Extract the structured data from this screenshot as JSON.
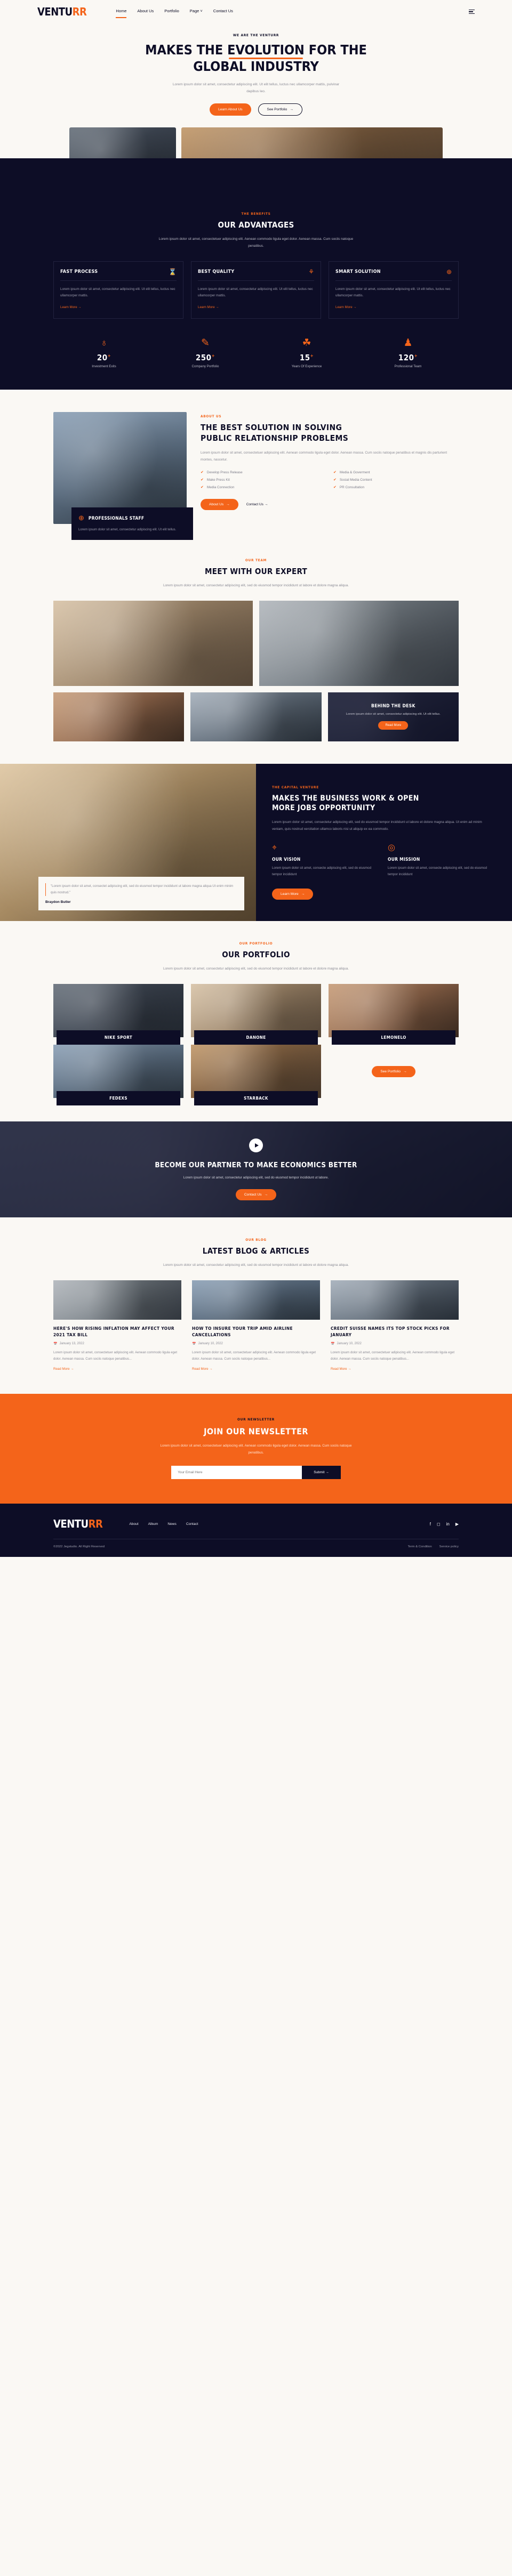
{
  "brand": {
    "name_dark": "VENTU",
    "name_accent": "RR"
  },
  "colors": {
    "accent": "#f4641a",
    "dark": "#0d0d26",
    "cream": "#faf8f4"
  },
  "nav": {
    "items": [
      {
        "label": "Home",
        "active": true
      },
      {
        "label": "About Us",
        "active": false
      },
      {
        "label": "Portfolio",
        "active": false
      },
      {
        "label": "Page",
        "active": false,
        "caret": "˅"
      },
      {
        "label": "Contact Us",
        "active": false
      }
    ],
    "menu_icon": "hamburger-icon"
  },
  "hero": {
    "eyebrow": "WE ARE THE VENTURR",
    "title_line1_a": "MAKES THE ",
    "title_line1_underlined": "EVOLUTION",
    "title_line1_b": " FOR THE",
    "title_line2": "GLOBAL INDUSTRY",
    "subtitle": "Lorem ipsum dolor sit amet, consectetur adipiscing elit. Ut elit tellus, luctus nec ullamcorper mattis, pulvinar dapibus leo.",
    "primary_button": "Learn About Us",
    "secondary_button": "See Portfolio",
    "arrow": "→"
  },
  "advantages": {
    "eyebrow": "THE BENEFITS",
    "title": "OUR ADVANTAGES",
    "subtitle": "Lorem ipsum dolor sit amet, consectetuer adipiscing elit. Aenean commodo ligula eget dolor. Aenean massa. Cum sociis natoque penatibus.",
    "cards": [
      {
        "title": "FAST PROCESS",
        "icon": "hourglass-icon",
        "glyph": "⌛",
        "text": "Lorem ipsum dolor sit amet, consectetur adipiscing elit. Ut elit tellus, luctus nec ullamcorper mattis.",
        "link": "Learn More"
      },
      {
        "title": "BEST QUALITY",
        "icon": "award-ribbon-icon",
        "glyph": "⚘",
        "text": "Lorem ipsum dolor sit amet, consectetur adipiscing elit. Ut elit tellus, luctus nec ullamcorper mattis.",
        "link": "Learn More"
      },
      {
        "title": "SMART SOLUTION",
        "icon": "brain-icon",
        "glyph": "⊕",
        "text": "Lorem ipsum dolor sit amet, consectetur adipiscing elit. Ut elit tellus, luctus nec ullamcorper mattis.",
        "link": "Learn More"
      }
    ],
    "link_arrow": "→",
    "stats": [
      {
        "icon": "globe-icon",
        "glyph": "♁",
        "value": "20",
        "plus": "+",
        "label": "Investment Exits"
      },
      {
        "icon": "document-pen-icon",
        "glyph": "✎",
        "value": "250",
        "plus": "+",
        "label": "Company Portfolio"
      },
      {
        "icon": "award-thumb-icon",
        "glyph": "☘",
        "value": "15",
        "plus": "+",
        "label": "Years Of Experience"
      },
      {
        "icon": "team-people-icon",
        "glyph": "♟",
        "value": "120",
        "plus": "+",
        "label": "Professional Team"
      }
    ]
  },
  "about": {
    "eyebrow": "ABOUT US",
    "title_line1": "THE BEST SOLUTION IN SOLVING",
    "title_line2": "PUBLIC RELATIONSHIP PROBLEMS",
    "body": "Lorem ipsum dolor sit amet, consectetuer adipiscing elit. Aenean commodo ligula eget dolor. Aenean massa. Cum sociis natoque penatibus et magnis dis parturient montes, nascetur.",
    "features": [
      "Develop Press Release",
      "Media & Goverment",
      "Make Press Kit",
      "Social Media Content",
      "Media Connection",
      "PR Consultation"
    ],
    "check_glyph": "✔",
    "primary_button": "About Us",
    "secondary_link": "Contact Us",
    "arrow": "→",
    "badge": {
      "icon": "brain-icon",
      "glyph": "⊕",
      "title": "PROFESSIONALS STAFF",
      "text": "Lorem ipsum dolor sit amet, consectetur adipiscing elit. Ut elit tellus."
    }
  },
  "team": {
    "eyebrow": "OUR TEAM",
    "title": "MEET WITH OUR EXPERT",
    "subtitle": "Lorem ipsum dolor sit amet, consectetur adipiscing elit, sed do eiusmod tempor incididunt ut labore et dolore magna aliqua.",
    "behind_desk": {
      "title": "BEHIND THE DESK",
      "text": "Lorem ipsum dolor sit amet, consectetur adipiscing elit. Ut elit tellus.",
      "button": "Read More"
    }
  },
  "capital": {
    "eyebrow": "THE CAPITAL VENTURE",
    "title_line1": "MAKES THE BUSINESS WORK & OPEN",
    "title_line2": "MORE JOBS OPPORTUNITY",
    "body": "Lorem ipsum dolor sit amet, consectetur adipiscing elit, sed do eiusmod tempor incididunt ut labore et dolore magna aliqua. Ut enim ad minim veniam, quis nostrud xercitation ullamco laboris nisi ut aliquip ex ea commodo.",
    "vision": {
      "icon": "target-crosshair-icon",
      "glyph": "⌖",
      "title": "OUR VISION",
      "text": "Lorem ipsum dolor sit amet, consecte adipiscing elit, sed do eiusmod tempor incididunt"
    },
    "mission": {
      "icon": "dartboard-icon",
      "glyph": "◎",
      "title": "OUR MISSION",
      "text": "Lorem ipsum dolor sit amet, consecte adipiscing elit, sed do eiusmod tempor incididunt"
    },
    "button": "Learn More",
    "arrow": "→",
    "quote": {
      "text": "\"Lorem ipsum dolor sit amet, consectet adipiscing elit, sed do eiusmod tempor incididunt ut labore magna aliqua Ut enim minim quis nostrud.\"",
      "author": "Braydon Butler"
    }
  },
  "portfolio": {
    "eyebrow": "OUR PORTFOLIO",
    "title": "OUR PORTFOLIO",
    "subtitle": "Lorem ipsum dolor sit amet, consectetur adipiscing elit, sed do eiusmod tempor incididunt ut labore et dolore magna aliqua.",
    "items": [
      {
        "label": "NIKE SPORT"
      },
      {
        "label": "DANONE"
      },
      {
        "label": "LEMONELO"
      },
      {
        "label": "FEDEXS"
      },
      {
        "label": "STARBACK"
      }
    ],
    "more_button": "See Portfolio",
    "arrow": "→"
  },
  "cta": {
    "play_icon": "play-icon",
    "title": "BECOME OUR PARTNER TO MAKE ECONOMICS BETTER",
    "text": "Lorem ipsum dolor sit amet, consectetur adipiscing elit, sed do eiusmod tempor incididunt ut labore.",
    "button": "Contact Us",
    "arrow": "→"
  },
  "blog": {
    "eyebrow": "OUR BLOG",
    "title": "LATEST BLOG & ARTICLES",
    "subtitle": "Lorem ipsum dolor sit amet, consectetur adipiscing elit, sed do eiusmod tempor incididunt ut labore et dolore magna aliqua.",
    "date_icon": "calendar-icon",
    "date_glyph": "Ὄ5",
    "read_more": "Read More",
    "arrow": "→",
    "posts": [
      {
        "title": "HERE'S HOW RISING INFLATION MAY AFFECT YOUR 2021 TAX BILL",
        "date": "January 13, 2022",
        "excerpt": "Lorem ipsum dolor sit amet, consectetuer adipiscing elit. Aenean commodo ligula eget dolor. Aenean massa. Cum sociis natoque penatibus..."
      },
      {
        "title": "HOW TO INSURE YOUR TRIP AMID AIRLINE CANCELLATIONS",
        "date": "January 10, 2022",
        "excerpt": "Lorem ipsum dolor sit amet, consectetuer adipiscing elit. Aenean commodo ligula eget dolor. Aenean massa. Cum sociis natoque penatibus..."
      },
      {
        "title": "CREDIT SUISSE NAMES ITS TOP STOCK PICKS FOR JANUARY",
        "date": "January 10, 2022",
        "excerpt": "Lorem ipsum dolor sit amet, consectetuer adipiscing elit. Aenean commodo ligula eget dolor. Aenean massa. Cum sociis natoque penatibus..."
      }
    ]
  },
  "newsletter": {
    "eyebrow": "OUR NEWSLETTER",
    "title": "JOIN OUR NEWSLETTER",
    "text": "Lorem ipsum dolor sit amet, consectetuer adipiscing elit. Aenean commodo ligula eget dolor. Aenean massa. Cum sociis natoque penatibus.",
    "placeholder": "Your Email Here",
    "submit": "Submit",
    "arrow": "→"
  },
  "footer": {
    "links": [
      "About",
      "Album",
      "News",
      "Contact"
    ],
    "social": [
      {
        "name": "facebook-icon",
        "glyph": "f"
      },
      {
        "name": "instagram-icon",
        "glyph": "◻"
      },
      {
        "name": "linkedin-icon",
        "glyph": "in"
      },
      {
        "name": "youtube-icon",
        "glyph": "▶"
      }
    ],
    "copyright": "©2022 Jegstudio. All Right Reserved",
    "legal": [
      "Term & Condition",
      "Service policy"
    ]
  }
}
